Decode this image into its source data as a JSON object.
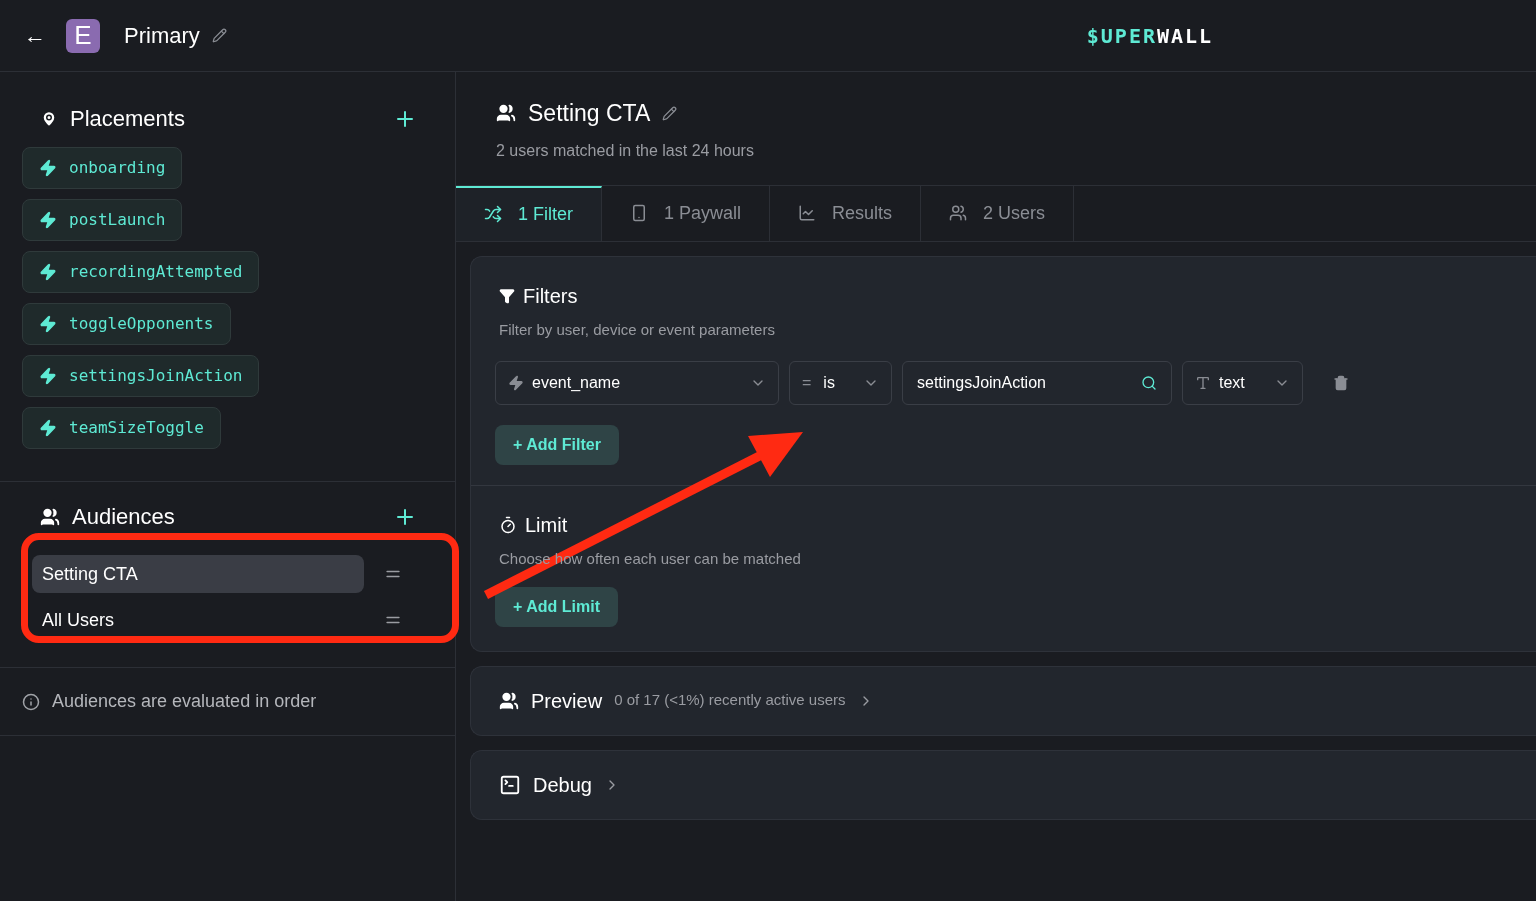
{
  "header": {
    "back": "←",
    "app_letter": "E",
    "title": "Primary",
    "logo": {
      "first": "$UPER",
      "second": "WALL"
    }
  },
  "placements": {
    "title": "Placements",
    "items": [
      "onboarding",
      "postLaunch",
      "recordingAttempted",
      "toggleOpponents",
      "settingsJoinAction",
      "teamSizeToggle"
    ]
  },
  "audiences": {
    "title": "Audiences",
    "items": [
      {
        "label": "Setting CTA",
        "selected": true
      },
      {
        "label": "All Users",
        "selected": false
      }
    ],
    "note": "Audiences are evaluated in order"
  },
  "audience": {
    "title": "Setting CTA",
    "subtitle": "2 users matched in the last 24 hours"
  },
  "tabs": [
    {
      "label": "1 Filter",
      "selected": true
    },
    {
      "label": "1 Paywall",
      "selected": false
    },
    {
      "label": "Results",
      "selected": false
    },
    {
      "label": "2 Users",
      "selected": false
    }
  ],
  "filters": {
    "title": "Filters",
    "subtitle": "Filter by user, device or event parameters",
    "row": {
      "field": "event_name",
      "operator_symbol": "=",
      "operator": "is",
      "value": "settingsJoinAction",
      "type": "text"
    },
    "add_button": "+ Add Filter"
  },
  "limit": {
    "title": "Limit",
    "subtitle": "Choose how often each user can be matched",
    "add_button": "+ Add Limit"
  },
  "preview": {
    "title": "Preview",
    "summary": "0 of 17 (<1%) recently active users"
  },
  "debug": {
    "title": "Debug"
  }
}
